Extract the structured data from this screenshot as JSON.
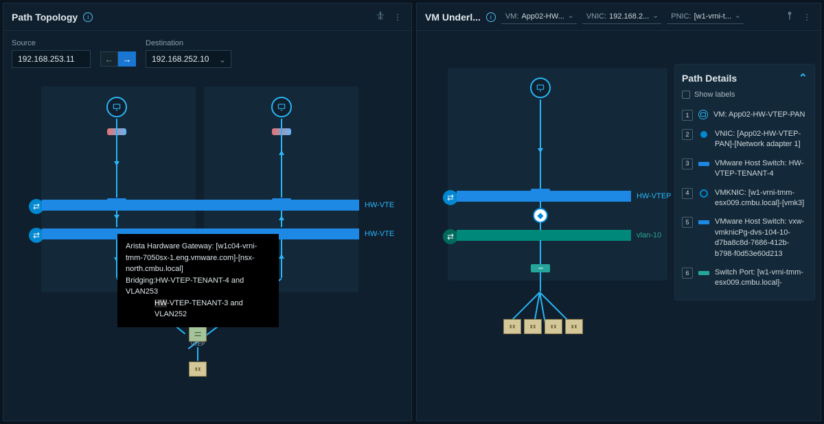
{
  "left": {
    "title": "Path Topology",
    "source_label": "Source",
    "source_value": "192.168.253.11",
    "dest_label": "Destination",
    "dest_value": "192.168.252.10",
    "bar1_label": "HW-VTE",
    "bar2_label": "HW-VTE",
    "vtep_label": "VTEP",
    "tooltip": {
      "line1": "Arista Hardware Gateway: [w1c04-vrni-tmm-7050sx-1.eng.vmware.com]-[nsx-north.cmbu.local]",
      "line2_pre": "Bridging:",
      "line2a": "HW-VTEP-TENANT-4 and VLAN253",
      "line2b_hl": "HW",
      "line2b": "-VTEP-TENANT-3 and VLAN252"
    }
  },
  "right": {
    "title": "VM Underl...",
    "dd_vm_label": "VM:",
    "dd_vm_value": "App02-HW...",
    "dd_vnic_label": "VNIC:",
    "dd_vnic_value": "192.168.2...",
    "dd_pnic_label": "PNIC:",
    "dd_pnic_value": "[w1-vrni-t...",
    "bar1_label": "HW-VTEP",
    "bar2_label": "vlan-10",
    "details": {
      "title": "Path Details",
      "show_labels": "Show labels",
      "items": [
        {
          "n": "1",
          "icon": "vm-ring",
          "text": "VM: App02-HW-VTEP-PAN"
        },
        {
          "n": "2",
          "icon": "dot-blue",
          "text": "VNIC: [App02-HW-VTEP-PAN]-[Network adapter 1]"
        },
        {
          "n": "3",
          "icon": "bar-blue",
          "text": "VMware Host Switch: HW-VTEP-TENANT-4"
        },
        {
          "n": "4",
          "icon": "ring-blue",
          "text": "VMKNIC: [w1-vrni-tmm-esx009.cmbu.local]-[vmk3]"
        },
        {
          "n": "5",
          "icon": "bar-blue",
          "text": "VMware Host Switch: vxw-vmknicPg-dvs-104-10-d7ba8c8d-7686-412b-b798-f0d53e60d213"
        },
        {
          "n": "6",
          "icon": "bar-teal",
          "text": "Switch Port: [w1-vrni-tmm-esx009.cmbu.local]-"
        }
      ]
    }
  }
}
